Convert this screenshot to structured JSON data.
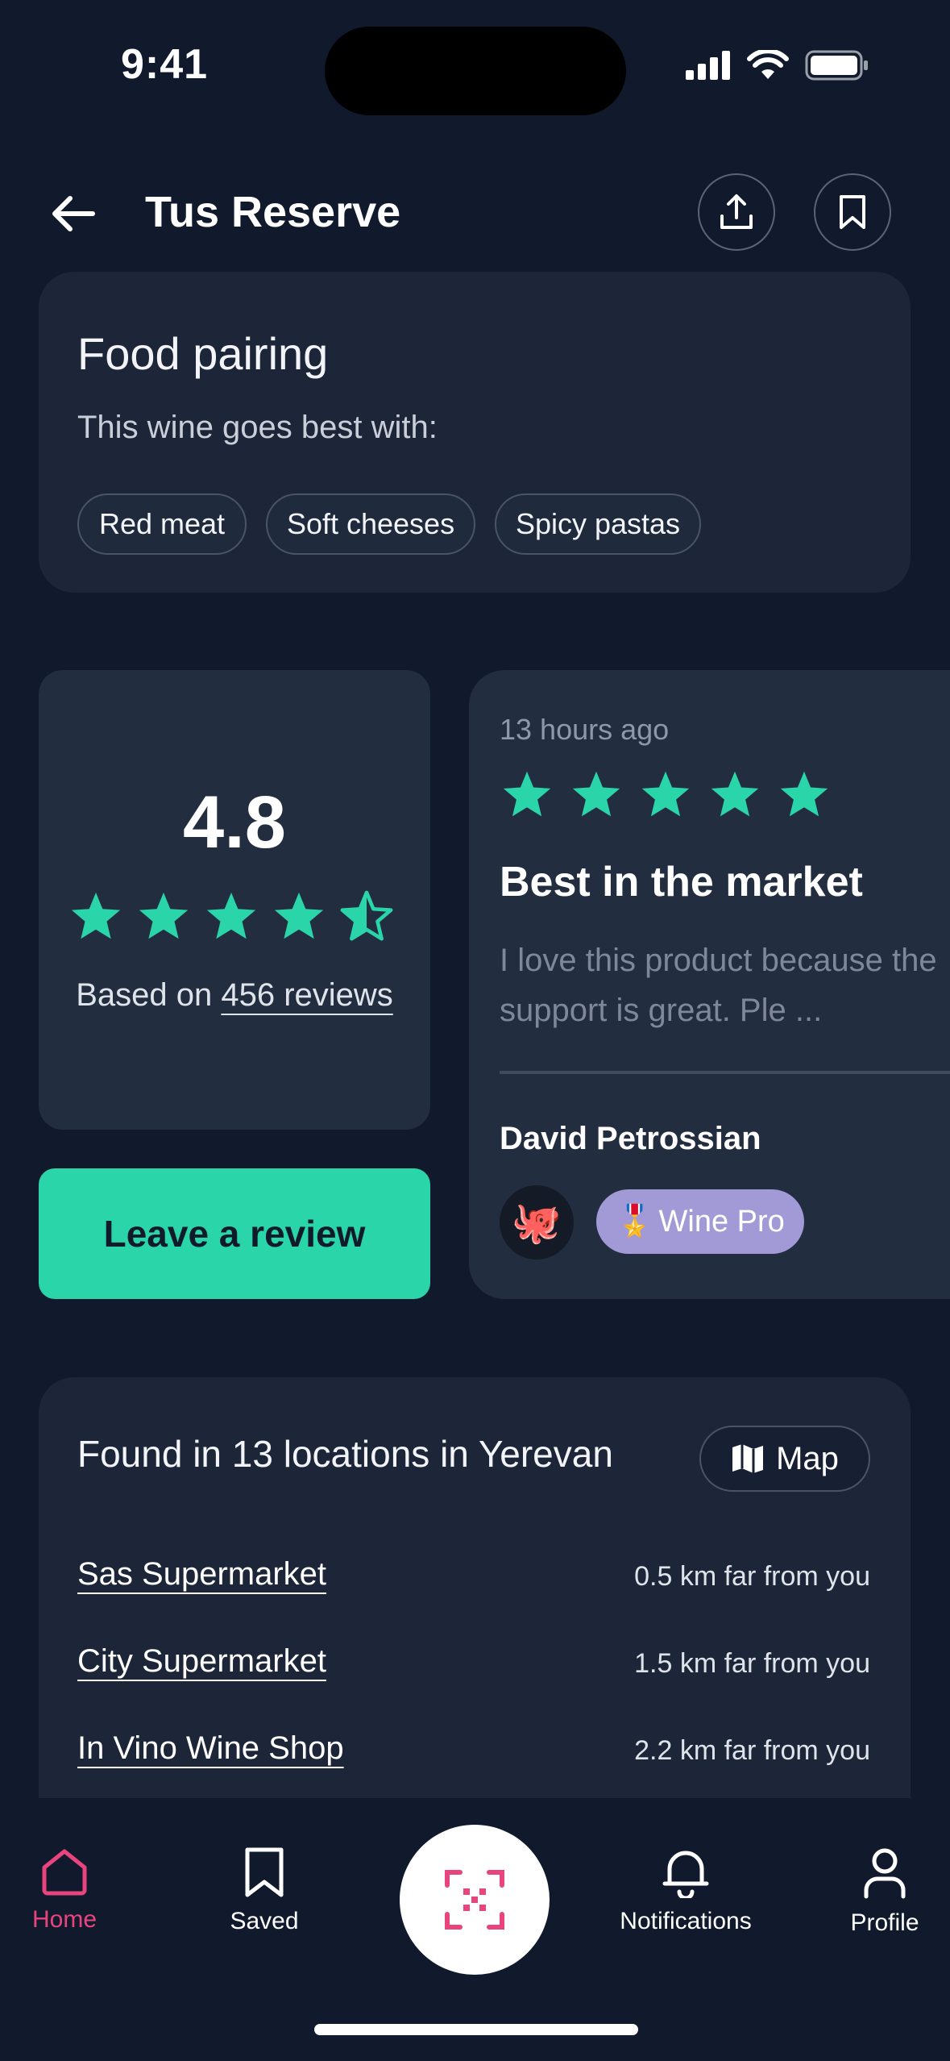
{
  "status_bar": {
    "time": "9:41"
  },
  "header": {
    "title": "Tus Reserve"
  },
  "food_pairing": {
    "title": "Food pairing",
    "subtitle": "This wine goes best with:",
    "chips": [
      "Red meat",
      "Soft cheeses",
      "Spicy pastas"
    ]
  },
  "rating": {
    "value": "4.8",
    "stars": 4.5,
    "based_prefix": "Based on",
    "reviews_link": "456 reviews"
  },
  "leave_review": {
    "label": "Leave a review"
  },
  "review": {
    "time": "13 hours ago",
    "stars": 5,
    "title": "Best in the market",
    "body_line1": "I love this product because the",
    "body_line2": "support is great. Ple ...",
    "author": "David Petrossian",
    "avatar_emoji": "🐙",
    "badge_emoji": "🎖️",
    "badge_label": "Wine Pro"
  },
  "locations": {
    "title": "Found in 13 locations in Yerevan",
    "map_label": "Map",
    "items": [
      {
        "name": "Sas Supermarket",
        "distance": "0.5 km far from you"
      },
      {
        "name": "City Supermarket",
        "distance": "1.5 km far from you"
      },
      {
        "name": "In Vino Wine Shop",
        "distance": "2.2 km far from you"
      }
    ]
  },
  "tabbar": {
    "home": "Home",
    "saved": "Saved",
    "notifications": "Notifications",
    "profile": "Profile"
  },
  "colors": {
    "background": "#111a2c",
    "card": "#1d2638",
    "accent_green": "#2ad5aa",
    "accent_pink": "#e8457f",
    "badge_purple": "#a29ad7"
  }
}
